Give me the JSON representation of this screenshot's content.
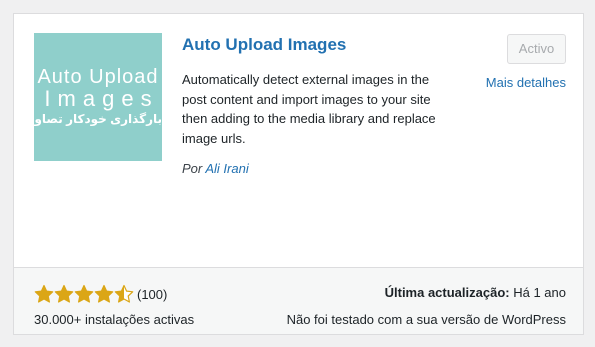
{
  "plugin": {
    "title": "Auto Upload Images",
    "thumbnail": {
      "line1": "Auto Upload",
      "line2": "Images",
      "line3": "بارگذاری خودکار تصاویر",
      "background": "#8fcfcb"
    },
    "description": "Automatically detect external images in the post content and import images to your site then adding to the media library and replace image urls.",
    "author_prefix": "Por",
    "author_name": "Ali Irani",
    "status_button": "Activo",
    "more_details": "Mais detalhes"
  },
  "footer": {
    "rating": {
      "value": 4.5,
      "max": 5,
      "count_label": "(100)",
      "star_color": "#dba617"
    },
    "installs": "30.000+ instalações activas",
    "last_updated_label": "Última actualização:",
    "last_updated_value": "Há 1 ano",
    "compatibility": "Não foi testado com a sua versão de WordPress"
  },
  "colors": {
    "link": "#2271b1",
    "text": "#1d2327",
    "page_bg": "#f0f0f1"
  }
}
